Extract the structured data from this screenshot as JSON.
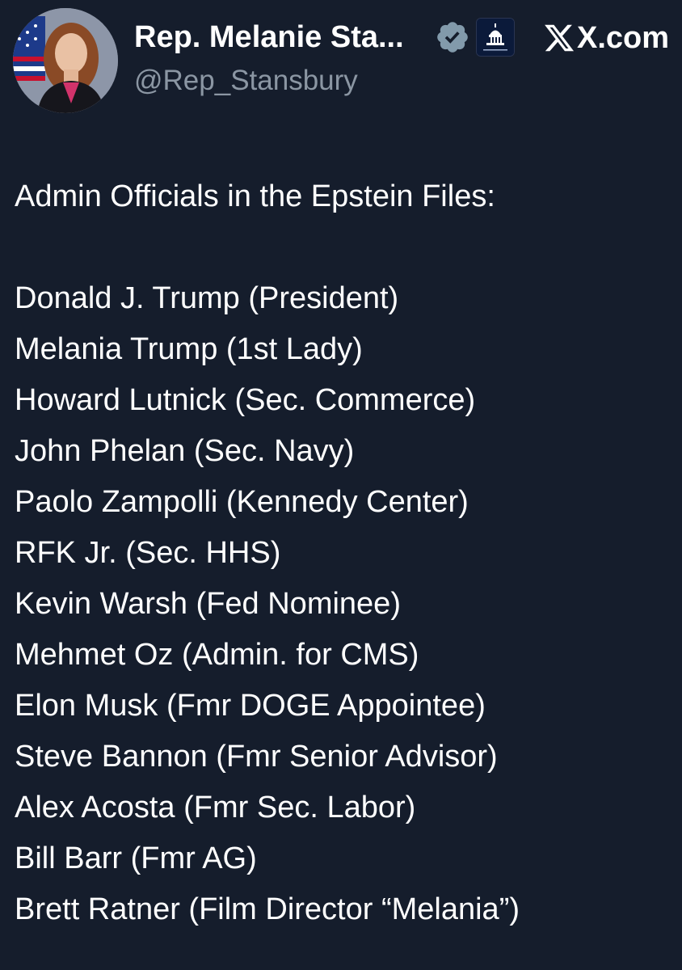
{
  "header": {
    "display_name": "Rep. Melanie Sta...",
    "handle": "@Rep_Stansbury",
    "domain": "X.com",
    "verified_icon": "verified-badge-icon",
    "affiliation_icon": "capitol-building-icon",
    "avatar_icon": "profile-photo"
  },
  "post": {
    "title": "Admin Officials in the Epstein Files:",
    "officials": [
      "Donald J. Trump (President)",
      "Melania Trump (1st Lady)",
      "Howard Lutnick (Sec. Commerce)",
      "John Phelan (Sec. Navy)",
      "Paolo Zampolli (Kennedy Center)",
      "RFK Jr. (Sec. HHS)",
      "Kevin Warsh (Fed Nominee)",
      "Mehmet Oz (Admin. for CMS)",
      "Elon Musk (Fmr DOGE Appointee)",
      "Steve Bannon (Fmr Senior Advisor)",
      "Alex Acosta (Fmr Sec. Labor)",
      "Bill Barr (Fmr AG)",
      "Brett Ratner (Film Director “Melania”)"
    ]
  },
  "colors": {
    "background": "#151d2c",
    "text": "#ffffff",
    "handle": "#8b96a3",
    "verified": "#829aab"
  }
}
